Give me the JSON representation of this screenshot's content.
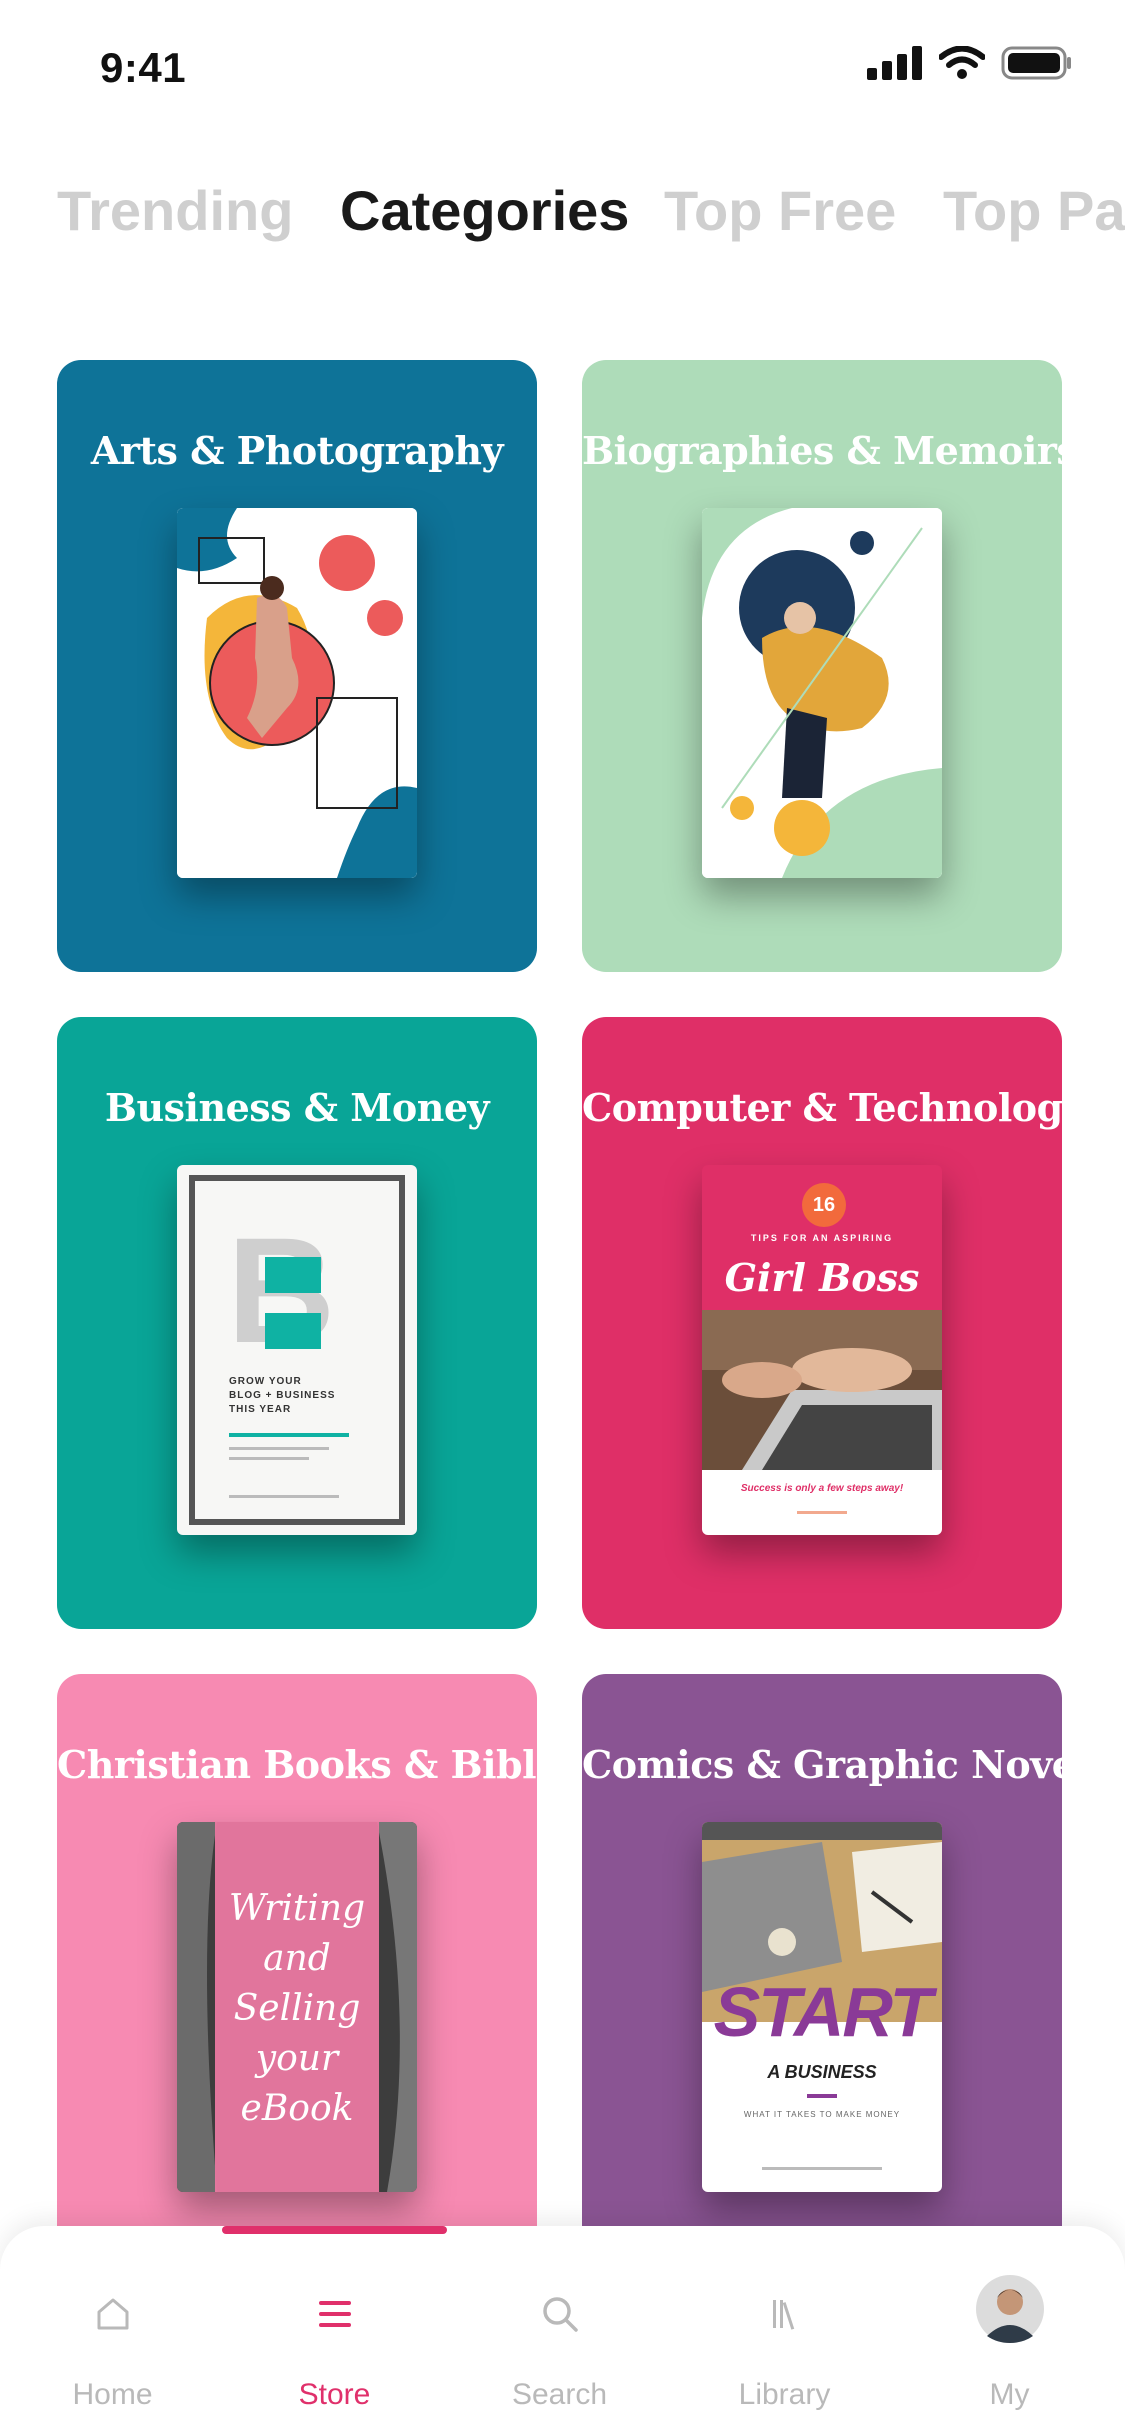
{
  "status_bar": {
    "time": "9:41"
  },
  "tabs": [
    {
      "label": "Trending"
    },
    {
      "label": "Categories"
    },
    {
      "label": "Top Free"
    },
    {
      "label": "Top Paid"
    }
  ],
  "categories": [
    {
      "title": "Arts & Photography",
      "color": "#0e7398"
    },
    {
      "title": "Biographies & Memoirs",
      "color": "#aedcb9"
    },
    {
      "title": "Business & Money",
      "color": "#09a597"
    },
    {
      "title": "Computer & Technology",
      "color": "#df2f67"
    },
    {
      "title": "Christian Books & Bibles",
      "color": "#f78ab2"
    },
    {
      "title": "Comics & Graphic Novels",
      "color": "#8a5493"
    }
  ],
  "covers": {
    "business": {
      "letter": "B",
      "lines": [
        "GROW YOUR",
        "BLOG + BUSINESS",
        "THIS YEAR"
      ]
    },
    "tech": {
      "number": "16",
      "subtitle": "TIPS FOR AN ASPIRING",
      "headline": "Girl Boss",
      "footer": "Success is only a few steps away!"
    },
    "christian": {
      "lines": [
        "Writing",
        "and",
        "Selling",
        "your",
        "eBook"
      ]
    },
    "comics": {
      "headline": "START",
      "subline": "A BUSINESS",
      "footer": "WHAT IT TAKES TO MAKE MONEY"
    }
  },
  "tabbar": [
    {
      "label": "Home",
      "icon": "home-icon"
    },
    {
      "label": "Store",
      "icon": "store-icon"
    },
    {
      "label": "Search",
      "icon": "search-icon"
    },
    {
      "label": "Library",
      "icon": "library-icon"
    },
    {
      "label": "My",
      "icon": "avatar"
    }
  ],
  "accent": "#e0306b"
}
